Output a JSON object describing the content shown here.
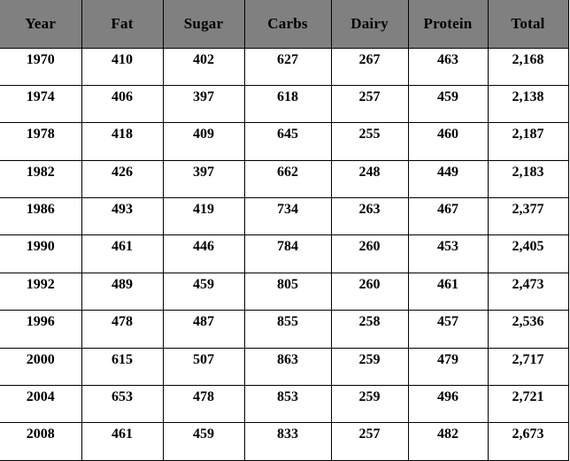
{
  "table": {
    "title": "",
    "colors": {
      "header_background": "#808080",
      "cell_background": "#ffffff",
      "text": "#000000",
      "border": "#000000"
    },
    "columns": [
      {
        "key": "year",
        "label": "Year"
      },
      {
        "key": "fat",
        "label": "Fat"
      },
      {
        "key": "sugar",
        "label": "Sugar"
      },
      {
        "key": "carbs",
        "label": "Carbs"
      },
      {
        "key": "dairy",
        "label": "Dairy"
      },
      {
        "key": "protein",
        "label": "Protein"
      },
      {
        "key": "total",
        "label": "Total"
      }
    ],
    "rows": [
      {
        "year": "1970",
        "fat": "410",
        "sugar": "402",
        "carbs": "627",
        "dairy": "267",
        "protein": "463",
        "total": "2,168"
      },
      {
        "year": "1974",
        "fat": "406",
        "sugar": "397",
        "carbs": "618",
        "dairy": "257",
        "protein": "459",
        "total": "2,138"
      },
      {
        "year": "1978",
        "fat": "418",
        "sugar": "409",
        "carbs": "645",
        "dairy": "255",
        "protein": "460",
        "total": "2,187"
      },
      {
        "year": "1982",
        "fat": "426",
        "sugar": "397",
        "carbs": "662",
        "dairy": "248",
        "protein": "449",
        "total": "2,183"
      },
      {
        "year": "1986",
        "fat": "493",
        "sugar": "419",
        "carbs": "734",
        "dairy": "263",
        "protein": "467",
        "total": "2,377"
      },
      {
        "year": "1990",
        "fat": "461",
        "sugar": "446",
        "carbs": "784",
        "dairy": "260",
        "protein": "453",
        "total": "2,405"
      },
      {
        "year": "1992",
        "fat": "489",
        "sugar": "459",
        "carbs": "805",
        "dairy": "260",
        "protein": "461",
        "total": "2,473"
      },
      {
        "year": "1996",
        "fat": "478",
        "sugar": "487",
        "carbs": "855",
        "dairy": "258",
        "protein": "457",
        "total": "2,536"
      },
      {
        "year": "2000",
        "fat": "615",
        "sugar": "507",
        "carbs": "863",
        "dairy": "259",
        "protein": "479",
        "total": "2,717"
      },
      {
        "year": "2004",
        "fat": "653",
        "sugar": "478",
        "carbs": "853",
        "dairy": "259",
        "protein": "496",
        "total": "2,721"
      },
      {
        "year": "2008",
        "fat": "461",
        "sugar": "459",
        "carbs": "833",
        "dairy": "257",
        "protein": "482",
        "total": "2,673"
      }
    ]
  },
  "chart_data": {
    "type": "table",
    "title": "",
    "columns": [
      "Year",
      "Fat",
      "Sugar",
      "Carbs",
      "Dairy",
      "Protein",
      "Total"
    ],
    "categories": [
      "1970",
      "1974",
      "1978",
      "1982",
      "1986",
      "1990",
      "1992",
      "1996",
      "2000",
      "2004",
      "2008"
    ],
    "series": [
      {
        "name": "Fat",
        "values": [
          410,
          406,
          418,
          426,
          493,
          461,
          489,
          478,
          615,
          653,
          461
        ]
      },
      {
        "name": "Sugar",
        "values": [
          402,
          397,
          409,
          397,
          419,
          446,
          459,
          487,
          507,
          478,
          459
        ]
      },
      {
        "name": "Carbs",
        "values": [
          627,
          618,
          645,
          662,
          734,
          784,
          805,
          855,
          863,
          853,
          833
        ]
      },
      {
        "name": "Dairy",
        "values": [
          267,
          257,
          255,
          248,
          263,
          260,
          260,
          258,
          259,
          259,
          257
        ]
      },
      {
        "name": "Protein",
        "values": [
          463,
          459,
          460,
          449,
          467,
          453,
          461,
          457,
          479,
          496,
          482
        ]
      },
      {
        "name": "Total",
        "values": [
          2168,
          2138,
          2187,
          2183,
          2377,
          2405,
          2473,
          2536,
          2717,
          2721,
          2673
        ]
      }
    ],
    "xlabel": "Year",
    "ylabel": "",
    "grid": true,
    "legend": "none"
  }
}
